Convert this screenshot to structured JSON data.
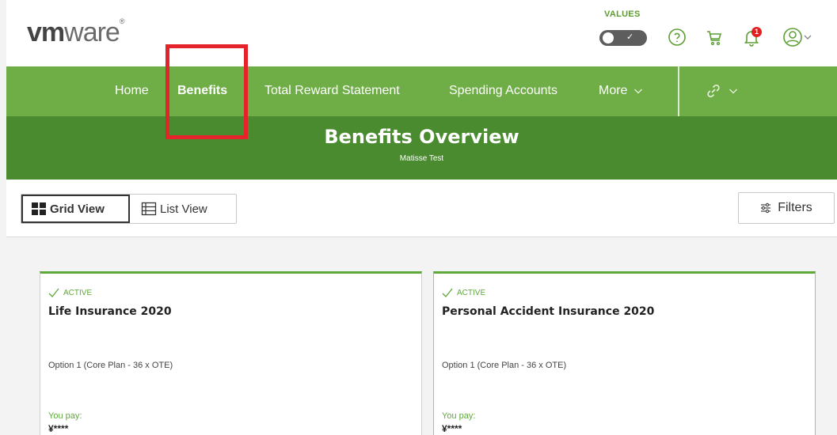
{
  "header": {
    "logo_bold": "vm",
    "logo_rest": "ware",
    "logo_mark": "®",
    "values_label": "VALUES",
    "toggle_glyph": "✓",
    "help_icon": "help-icon",
    "cart_icon": "cart-icon",
    "bell_icon": "bell-icon",
    "notification_count": "1",
    "user_icon": "user-icon"
  },
  "nav": {
    "items": [
      {
        "label": "Home"
      },
      {
        "label": "Benefits"
      },
      {
        "label": "Total Reward Statement"
      },
      {
        "label": "Spending Accounts"
      },
      {
        "label": "More"
      }
    ],
    "link_icon": "link-icon"
  },
  "hero": {
    "title": "Benefits Overview",
    "subtitle": "Matisse Test"
  },
  "toolbar": {
    "grid_label": "Grid View",
    "list_label": "List View",
    "filters_label": "Filters"
  },
  "cards": [
    {
      "status": "ACTIVE",
      "title": "Life Insurance 2020",
      "option": "Option 1 (Core Plan - 36 x OTE)",
      "pay_label": "You pay:",
      "pay_value": "¥****"
    },
    {
      "status": "ACTIVE",
      "title": "Personal Accident Insurance 2020",
      "option": "Option 1 (Core Plan - 36 x OTE)",
      "pay_label": "You pay:",
      "pay_value": "¥****"
    }
  ],
  "colors": {
    "nav_green": "#6fad46",
    "hero_green": "#4b8b2f",
    "active_green": "#5fa83a",
    "highlight_red": "#e5232a"
  }
}
